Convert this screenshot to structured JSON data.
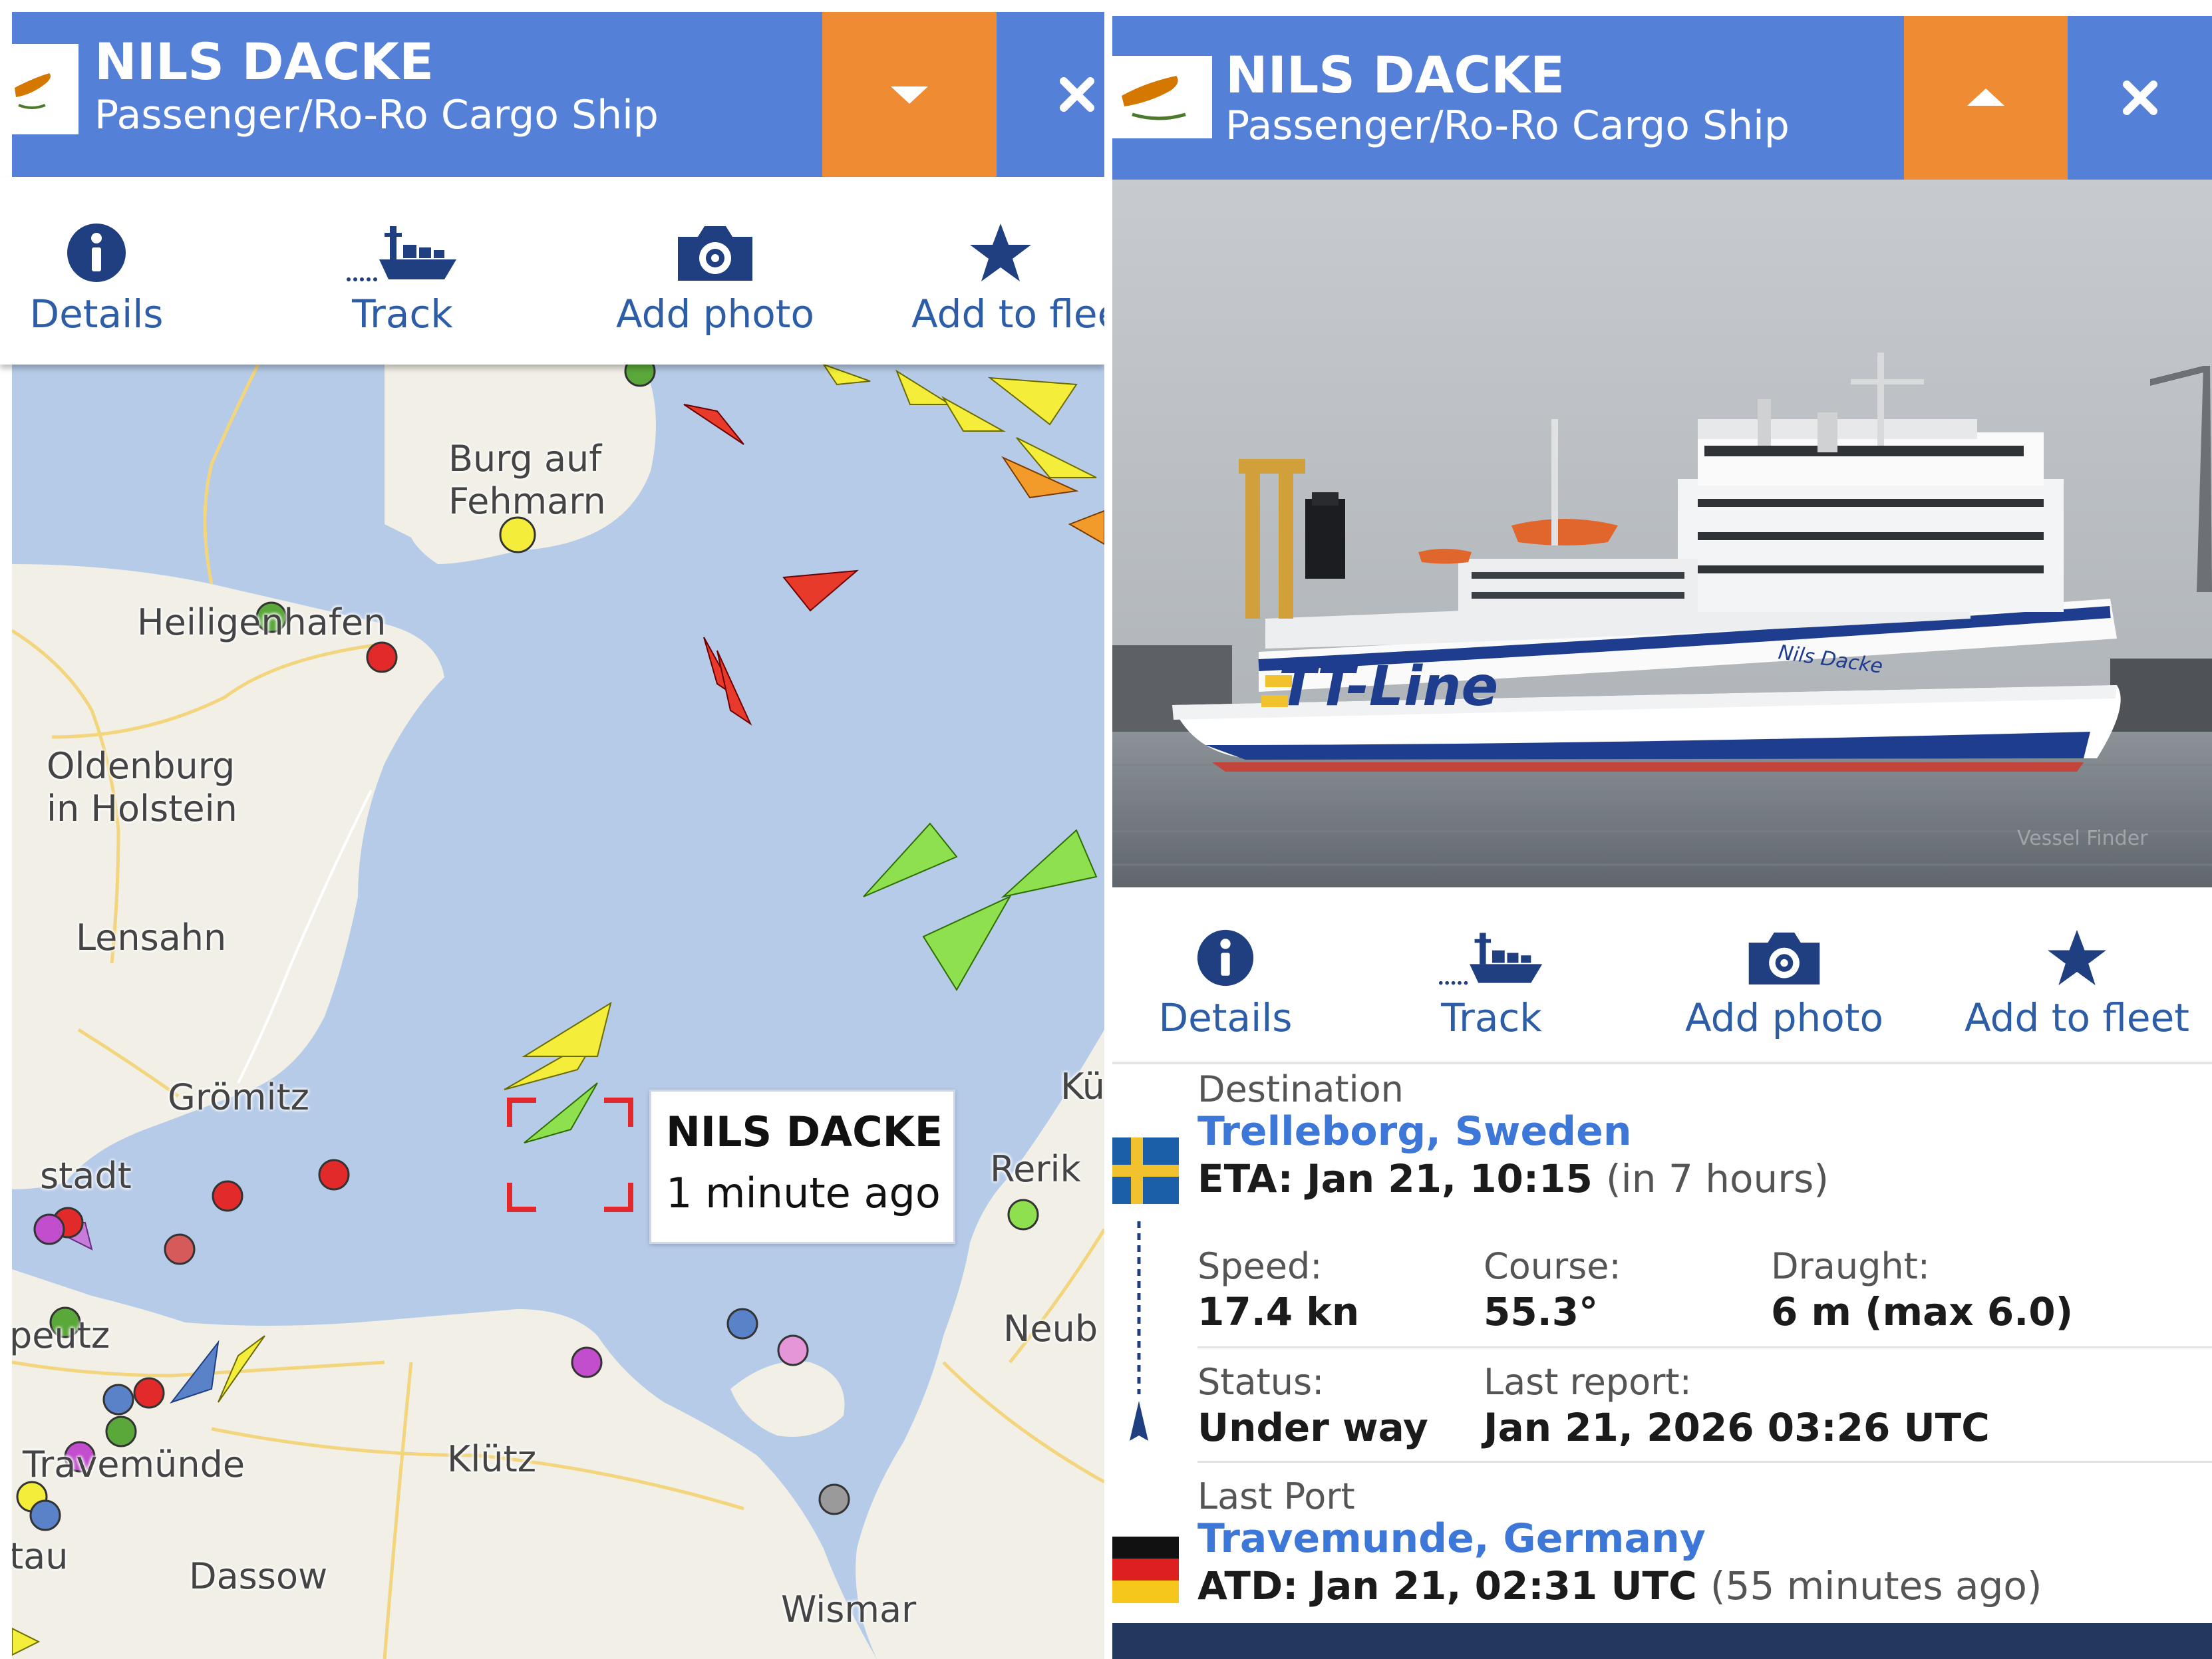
{
  "vessel": {
    "name": "NILS DACKE",
    "type": "Passenger/Ro-Ro Cargo Ship"
  },
  "actions": {
    "details": "Details",
    "track": "Track",
    "add_photo": "Add photo",
    "add_to_fleet_truncated": "Add to flee",
    "add_to_fleet": "Add to fleet"
  },
  "map": {
    "labels": {
      "burg": "Burg auf",
      "fehmarn": "Fehmarn",
      "heiligenhafen": "Heiligenhafen",
      "oldenburg": "Oldenburg",
      "in_holstein": "in Holstein",
      "lensahn": "Lensahn",
      "gromitz": "Grömitz",
      "neustadt": "stadt",
      "rerik": "Rerik",
      "ku": "Kü",
      "neub": "Neub",
      "peutz": "peutz",
      "travemunde": "Travemünde",
      "klutz": "Klütz",
      "tau": "tau",
      "dassow": "Dassow",
      "wismar": "Wismar"
    },
    "popup": {
      "name": "NILS DACKE",
      "time": "1 minute ago"
    }
  },
  "photo": {
    "hull_text": "TT-Line",
    "hull_name": "Nils Dacke",
    "watermark": "Vessel Finder"
  },
  "destination": {
    "label": "Destination",
    "place": "Trelleborg, Sweden",
    "eta_label": "ETA:",
    "eta": "Jan 21, 10:15",
    "eta_relative": "(in 7 hours)"
  },
  "stats": {
    "speed_label": "Speed:",
    "speed": "17.4 kn",
    "course_label": "Course:",
    "course": "55.3°",
    "draught_label": "Draught:",
    "draught": "6 m (max 6.0)",
    "status_label": "Status:",
    "status": "Under way",
    "last_report_label": "Last report:",
    "last_report": "Jan 21, 2026 03:26 UTC"
  },
  "last_port": {
    "label": "Last Port",
    "place": "Travemunde, Germany",
    "atd_label": "ATD:",
    "atd": "Jan 21, 02:31 UTC",
    "atd_relative": "(55 minutes ago)"
  },
  "colors": {
    "header_blue": "#5580d8",
    "toggle_orange": "#ef8c33",
    "link_blue": "#3d78d8",
    "icon_navy": "#1f3f80",
    "sea": "#b6cbe8",
    "land": "#f1efe6"
  }
}
